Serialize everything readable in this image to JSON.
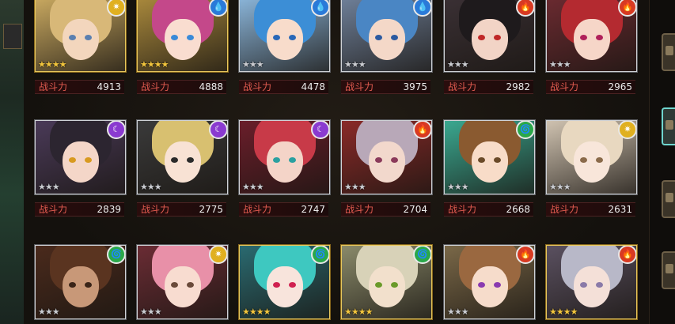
{
  "power_label": "战斗力",
  "rows": [
    [
      {
        "power": "4913",
        "element": "light",
        "rarity": "gold",
        "stars": 4,
        "hair": "#d8b878",
        "skin": "#f3d6bd",
        "eye": "#5a7fb0",
        "bg": "#c8a860"
      },
      {
        "power": "4888",
        "element": "water",
        "rarity": "gold",
        "stars": 4,
        "hair": "#c4488a",
        "skin": "#f9ddd0",
        "eye": "#3a8ad8",
        "bg": "#a8883c"
      },
      {
        "power": "4478",
        "element": "water",
        "rarity": "silver",
        "stars": 3,
        "hair": "#3c8ed6",
        "skin": "#f8dccb",
        "eye": "#2a68b8",
        "bg": "#8ab4d8"
      },
      {
        "power": "3975",
        "element": "water",
        "rarity": "silver",
        "stars": 3,
        "hair": "#4a86c4",
        "skin": "#f4d8c8",
        "eye": "#2c5aa0",
        "bg": "#6e7f98"
      },
      {
        "power": "2982",
        "element": "fire",
        "rarity": "silver",
        "stars": 3,
        "hair": "#1e1a1c",
        "skin": "#f2d4c6",
        "eye": "#c02828",
        "bg": "#3a3034"
      },
      {
        "power": "2965",
        "element": "fire",
        "rarity": "silver",
        "stars": 3,
        "hair": "#b42a30",
        "skin": "#f6d6c8",
        "eye": "#b0205a",
        "bg": "#6a2a30"
      }
    ],
    [
      {
        "power": "2839",
        "element": "dark",
        "rarity": "silver",
        "stars": 3,
        "hair": "#2c2530",
        "skin": "#f4d6c8",
        "eye": "#d89a20",
        "bg": "#4a3a58"
      },
      {
        "power": "2775",
        "element": "dark",
        "rarity": "silver",
        "stars": 3,
        "hair": "#d8c070",
        "skin": "#f8e2d4",
        "eye": "#2a2a2a",
        "bg": "#3a3a3a"
      },
      {
        "power": "2747",
        "element": "dark",
        "rarity": "silver",
        "stars": 3,
        "hair": "#c83a48",
        "skin": "#f4d4c8",
        "eye": "#2aa0a0",
        "bg": "#6a1e2a"
      },
      {
        "power": "2704",
        "element": "fire",
        "rarity": "silver",
        "stars": 3,
        "hair": "#b8a8b8",
        "skin": "#f2d8cc",
        "eye": "#8a3a5a",
        "bg": "#8a2a28"
      },
      {
        "power": "2668",
        "element": "wind",
        "rarity": "silver",
        "stars": 3,
        "hair": "#8a5a30",
        "skin": "#f8dcc8",
        "eye": "#6a4a28",
        "bg": "#3aa890"
      },
      {
        "power": "2631",
        "element": "light",
        "rarity": "silver",
        "stars": 3,
        "hair": "#e8d8c0",
        "skin": "#f8e6da",
        "eye": "#8a6a4a",
        "bg": "#cfc2b0"
      }
    ],
    [
      {
        "power": "",
        "element": "wind",
        "rarity": "silver",
        "stars": 3,
        "hair": "#5a3420",
        "skin": "#c89878",
        "eye": "#3a2418",
        "bg": "#4a2a1c"
      },
      {
        "power": "",
        "element": "light",
        "rarity": "silver",
        "stars": 3,
        "hair": "#e890a8",
        "skin": "#f8dcd0",
        "eye": "#6a4a3a",
        "bg": "#6a2c34"
      },
      {
        "power": "",
        "element": "wind",
        "rarity": "gold",
        "stars": 4,
        "hair": "#3ec8c0",
        "skin": "#f8e4dc",
        "eye": "#d02050",
        "bg": "#2a6a70"
      },
      {
        "power": "",
        "element": "wind",
        "rarity": "gold",
        "stars": 4,
        "hair": "#d8d2b8",
        "skin": "#f2e0cc",
        "eye": "#6a9a2a",
        "bg": "#8a8a6a"
      },
      {
        "power": "",
        "element": "fire",
        "rarity": "silver",
        "stars": 3,
        "hair": "#9a6840",
        "skin": "#f6dccb",
        "eye": "#8a3ab0",
        "bg": "#7a6848"
      },
      {
        "power": "",
        "element": "fire",
        "rarity": "gold",
        "stars": 4,
        "hair": "#b8b8c8",
        "skin": "#f4e0d8",
        "eye": "#8a7aa8",
        "bg": "#5a5060"
      }
    ]
  ],
  "elements": {
    "light": {
      "color": "#e0b020",
      "glyph": "✷"
    },
    "water": {
      "color": "#2a7ad8",
      "glyph": "💧"
    },
    "fire": {
      "color": "#d83a22",
      "glyph": "🔥"
    },
    "dark": {
      "color": "#8a3ad0",
      "glyph": "☾"
    },
    "wind": {
      "color": "#2aa84a",
      "glyph": "🌀"
    }
  }
}
